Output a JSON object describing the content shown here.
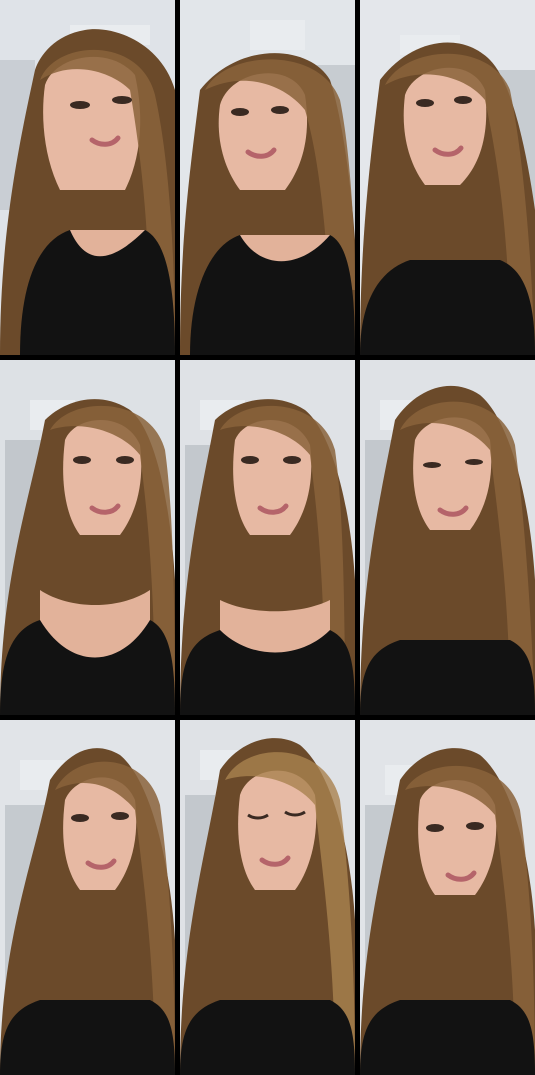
{
  "grid": {
    "rows": 3,
    "cols": 3,
    "frames": [
      {
        "id": 1,
        "scene": "light-wall",
        "door": "right",
        "outfit": "black-top",
        "eyes": "open"
      },
      {
        "id": 2,
        "scene": "light-wall",
        "door": "right",
        "outfit": "black-top",
        "eyes": "open"
      },
      {
        "id": 3,
        "scene": "light-wall",
        "door": "right",
        "outfit": "black-top",
        "eyes": "open"
      },
      {
        "id": 4,
        "scene": "light-wall",
        "door": "left",
        "outfit": "black-top",
        "eyes": "open"
      },
      {
        "id": 5,
        "scene": "light-wall",
        "door": "left",
        "outfit": "black-top",
        "eyes": "open"
      },
      {
        "id": 6,
        "scene": "light-wall",
        "door": "left",
        "outfit": "black-top",
        "eyes": "open"
      },
      {
        "id": 7,
        "scene": "light-wall",
        "door": "left",
        "outfit": "black-top",
        "eyes": "open"
      },
      {
        "id": 8,
        "scene": "light-wall",
        "door": "left",
        "outfit": "black-top",
        "eyes": "closed"
      },
      {
        "id": 9,
        "scene": "light-wall",
        "door": "left",
        "outfit": "black-top",
        "eyes": "open"
      }
    ]
  },
  "colors": {
    "background": "#000000",
    "wall": "#d9dde2",
    "door": "#b9bec4",
    "hair": "#6b4a2a",
    "hair_highlight": "#a9824f",
    "skin": "#e7b9a3",
    "top": "#121212"
  }
}
